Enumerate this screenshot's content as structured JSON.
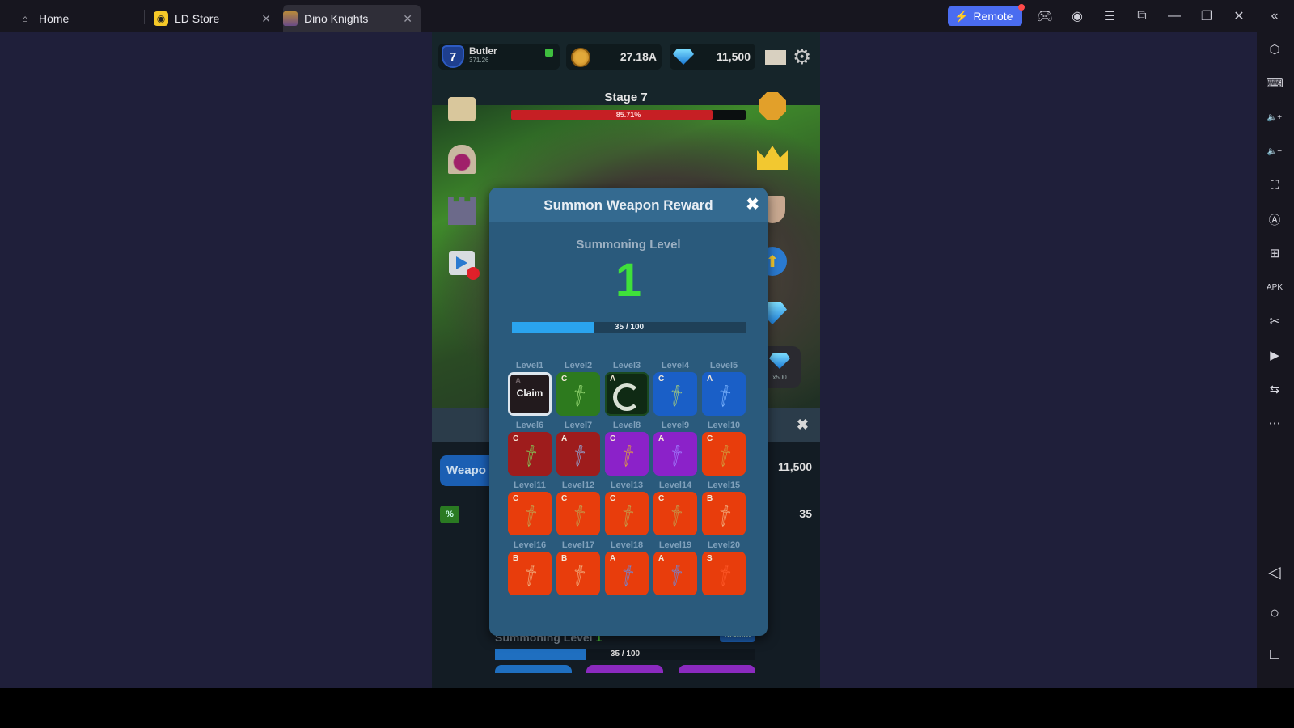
{
  "titlebar": {
    "tabs": [
      {
        "label": "Home",
        "icon": "home-icon",
        "active": false
      },
      {
        "label": "LD Store",
        "icon": "gamepad-icon",
        "active": false,
        "closable": true
      },
      {
        "label": "Dino Knights",
        "icon": "app-icon",
        "active": true,
        "closable": true
      }
    ],
    "remote_label": "Remote",
    "controls": [
      "gamepad-icon",
      "account-icon",
      "menu-icon",
      "resize-icon",
      "minimize-icon",
      "restore-icon",
      "close-icon",
      "collapse-icon"
    ]
  },
  "sidebar": {
    "items": [
      {
        "name": "settings-hex-icon",
        "glyph": "⬡"
      },
      {
        "name": "keyboard-icon",
        "glyph": "⌨"
      },
      {
        "name": "volume-up-icon",
        "glyph": "🔈+"
      },
      {
        "name": "volume-down-icon",
        "glyph": "🔈−"
      },
      {
        "name": "fullscreen-icon",
        "glyph": "⛶"
      },
      {
        "name": "auto-rotate-icon",
        "glyph": "Ⓐ"
      },
      {
        "name": "add-instance-icon",
        "glyph": "⊞"
      },
      {
        "name": "apk-install-icon",
        "glyph": "APK"
      },
      {
        "name": "scissors-icon",
        "glyph": "✂"
      },
      {
        "name": "video-record-icon",
        "glyph": "▶"
      },
      {
        "name": "sync-icon",
        "glyph": "⇆"
      },
      {
        "name": "more-icon",
        "glyph": "⋯"
      }
    ],
    "nav": [
      {
        "name": "back-icon",
        "glyph": "◁"
      },
      {
        "name": "home-circle-icon",
        "glyph": "○"
      },
      {
        "name": "recents-icon",
        "glyph": "□"
      }
    ]
  },
  "game": {
    "player": {
      "level": "7",
      "name": "Butler",
      "power": "371.26"
    },
    "gold": "27.18A",
    "gems": "11,500",
    "stage": {
      "title": "Stage 7",
      "progress_label": "85.71%",
      "progress": 0.8571
    },
    "side_reward_gems": "x500",
    "lower": {
      "weapon_tab": "Weapo",
      "pct_badge": "%",
      "gems": "11,500",
      "count": "35",
      "summon_label": "Summoning Level",
      "summon_level": "1",
      "reward_btn": "Reward",
      "progress_label": "35 / 100",
      "progress": 0.35
    }
  },
  "modal": {
    "title": "Summon Weapon Reward",
    "close": "✖",
    "summoning_label": "Summoning Level",
    "summoning_level": "1",
    "progress_label": "35 / 100",
    "progress": 0.35,
    "claim_label": "Claim",
    "rewards": [
      {
        "level": "Level1",
        "grade": "A",
        "color": "#221a1d",
        "state": "claim"
      },
      {
        "level": "Level2",
        "grade": "C",
        "color": "#2d7a1e",
        "weapon": "#9fe07a"
      },
      {
        "level": "Level3",
        "grade": "A",
        "color": "#2d7a1e",
        "state": "loading"
      },
      {
        "level": "Level4",
        "grade": "C",
        "color": "#1a5fc7",
        "weapon": "#a8d07a"
      },
      {
        "level": "Level5",
        "grade": "A",
        "color": "#1a5fc7",
        "weapon": "#7fb6ff"
      },
      {
        "level": "Level6",
        "grade": "C",
        "color": "#9e1c1c",
        "weapon": "#7fd05a"
      },
      {
        "level": "Level7",
        "grade": "A",
        "color": "#9e1c1c",
        "weapon": "#8fb0e0"
      },
      {
        "level": "Level8",
        "grade": "C",
        "color": "#8b22c9",
        "weapon": "#e0a040"
      },
      {
        "level": "Level9",
        "grade": "A",
        "color": "#8b22c9",
        "weapon": "#a080ff"
      },
      {
        "level": "Level10",
        "grade": "C",
        "color": "#e83d0c",
        "weapon": "#d0a040"
      },
      {
        "level": "Level11",
        "grade": "C",
        "color": "#e83d0c",
        "weapon": "#c0a050"
      },
      {
        "level": "Level12",
        "grade": "C",
        "color": "#e83d0c",
        "weapon": "#c0a050"
      },
      {
        "level": "Level13",
        "grade": "C",
        "color": "#e83d0c",
        "weapon": "#c0a050"
      },
      {
        "level": "Level14",
        "grade": "C",
        "color": "#e83d0c",
        "weapon": "#c0a050"
      },
      {
        "level": "Level15",
        "grade": "B",
        "color": "#e83d0c",
        "weapon": "#f0b080"
      },
      {
        "level": "Level16",
        "grade": "B",
        "color": "#e83d0c",
        "weapon": "#f0b080"
      },
      {
        "level": "Level17",
        "grade": "B",
        "color": "#e83d0c",
        "weapon": "#f0b080"
      },
      {
        "level": "Level18",
        "grade": "A",
        "color": "#e83d0c",
        "weapon": "#6a8ae0"
      },
      {
        "level": "Level19",
        "grade": "A",
        "color": "#e83d0c",
        "weapon": "#6a8ae0"
      },
      {
        "level": "Level20",
        "grade": "S",
        "color": "#e83d0c",
        "weapon": "#ff5a2a"
      }
    ]
  }
}
